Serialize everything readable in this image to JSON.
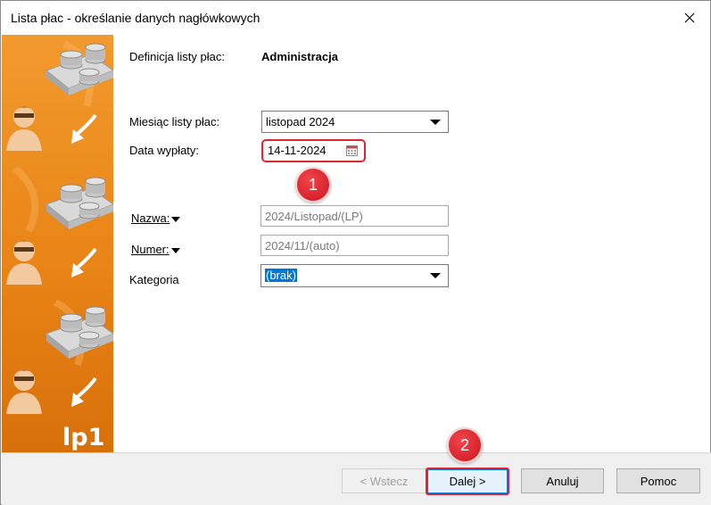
{
  "window": {
    "title": "Lista płac - określanie danych nagłówkowych"
  },
  "side_panel": {
    "logo_text": "lp1"
  },
  "form": {
    "definition_label": "Definicja listy płac:",
    "definition_value": "Administracja",
    "month_label": "Miesiąc listy płac:",
    "month_value": "listopad 2024",
    "date_label": "Data wypłaty:",
    "date_value": "14-11-2024",
    "name_label": "Nazwa:",
    "name_value": "2024/Listopad/(LP)",
    "number_label": "Numer:",
    "number_value": "2024/11/(auto)",
    "category_label": "Kategoria",
    "category_value": "(brak)"
  },
  "annotations": {
    "badge1": "1",
    "badge2": "2"
  },
  "buttons": {
    "back": "< Wstecz",
    "next": "Dalej >",
    "cancel": "Anuluj",
    "help": "Pomoc"
  },
  "colors": {
    "accent_orange": "#e98416",
    "highlight_red": "#e0252f",
    "selection_blue": "#0078d7"
  }
}
